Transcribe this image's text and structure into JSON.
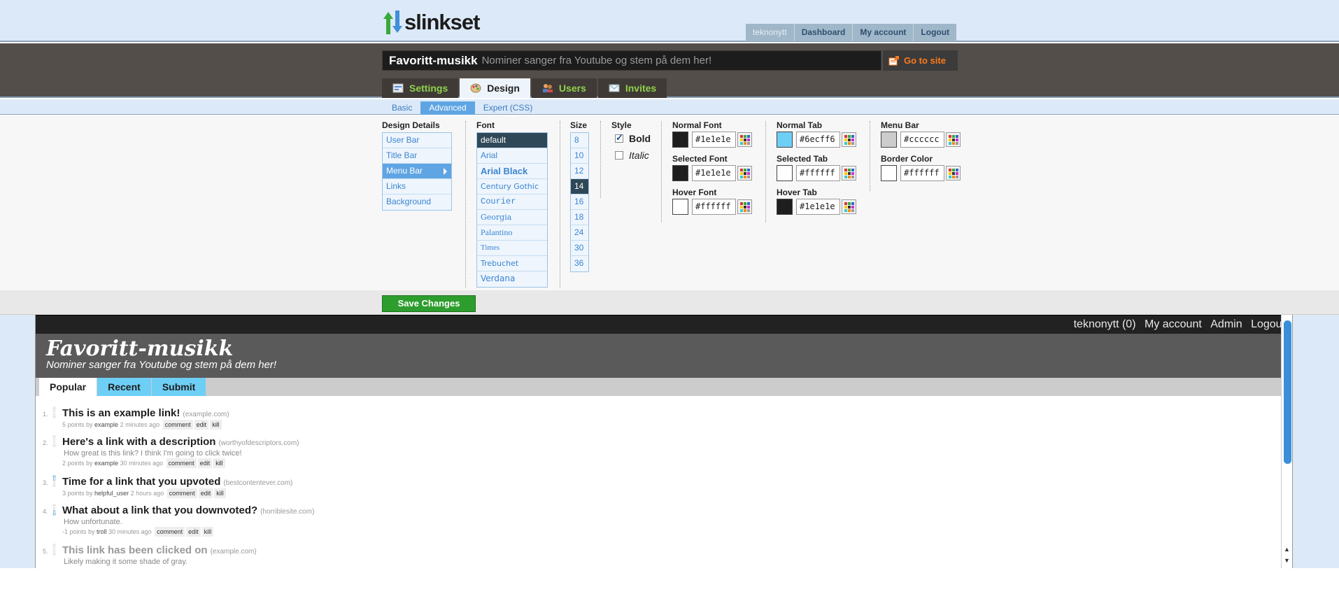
{
  "app": {
    "logo_text": "slinkset"
  },
  "topnav": {
    "user": "teknonytt",
    "dashboard": "Dashboard",
    "my_account": "My account",
    "logout": "Logout"
  },
  "site": {
    "name": "Favoritt-musikk",
    "tagline": "Nominer sanger fra Youtube og stem på dem her!",
    "goto": "Go to site"
  },
  "tabs": [
    {
      "label": "Settings",
      "icon": "settings-icon"
    },
    {
      "label": "Design",
      "icon": "palette-icon",
      "active": true
    },
    {
      "label": "Users",
      "icon": "users-icon"
    },
    {
      "label": "Invites",
      "icon": "envelope-icon"
    }
  ],
  "subtabs": [
    {
      "label": "Basic"
    },
    {
      "label": "Advanced",
      "active": true
    },
    {
      "label": "Expert (CSS)"
    }
  ],
  "design": {
    "details_label": "Design Details",
    "details": [
      "User Bar",
      "Title Bar",
      "Menu Bar",
      "Links",
      "Background"
    ],
    "details_selected": "Menu Bar",
    "font_label": "Font",
    "fonts": [
      "default",
      "Arial",
      "Arial Black",
      "Century Gothic",
      "Courier",
      "Georgia",
      "Palantino",
      "Times",
      "Trebuchet",
      "Verdana"
    ],
    "font_selected": "default",
    "size_label": "Size",
    "sizes": [
      "8",
      "10",
      "12",
      "14",
      "16",
      "18",
      "24",
      "30",
      "36"
    ],
    "size_selected": "14",
    "style_label": "Style",
    "bold": "Bold",
    "italic": "Italic",
    "bold_checked": true,
    "italic_checked": false,
    "colors": {
      "normal_font": {
        "label": "Normal Font",
        "value": "#1e1e1e",
        "swatch": "#1e1e1e"
      },
      "selected_font": {
        "label": "Selected Font",
        "value": "#1e1e1e",
        "swatch": "#1e1e1e"
      },
      "hover_font": {
        "label": "Hover Font",
        "value": "#ffffff",
        "swatch": "#ffffff"
      },
      "normal_tab": {
        "label": "Normal Tab",
        "value": "#6ecff6",
        "swatch": "#6ecff6"
      },
      "selected_tab": {
        "label": "Selected Tab",
        "value": "#ffffff",
        "swatch": "#ffffff"
      },
      "hover_tab": {
        "label": "Hover Tab",
        "value": "#1e1e1e",
        "swatch": "#1e1e1e"
      },
      "menu_bar": {
        "label": "Menu Bar",
        "value": "#cccccc",
        "swatch": "#cccccc"
      },
      "border_color": {
        "label": "Border Color",
        "value": "#ffffff",
        "swatch": "#ffffff"
      }
    },
    "save": "Save Changes"
  },
  "preview": {
    "nav": [
      "teknonytt (0)",
      "My account",
      "Admin",
      "Logout"
    ],
    "title": "Favoritt-musikk",
    "tagline": "Nominer sanger fra Youtube og stem på dem her!",
    "menu": [
      "Popular",
      "Recent",
      "Submit"
    ],
    "menu_selected": "Popular",
    "links": [
      {
        "num": "1.",
        "title": "This is an example link!",
        "domain": "(example.com)",
        "desc": "",
        "points": "5 points by",
        "user": "example",
        "age": "2 minutes ago",
        "vote": "none"
      },
      {
        "num": "2.",
        "title": "Here's a link with a description",
        "domain": "(worthyofdescriptors.com)",
        "desc": "How great is this link? I think I'm going to click twice!",
        "points": "2 points by",
        "user": "example",
        "age": "30 minutes ago",
        "vote": "none"
      },
      {
        "num": "3.",
        "title": "Time for a link that you upvoted",
        "domain": "(bestcontentever.com)",
        "desc": "",
        "points": "3 points by",
        "user": "helpful_user",
        "age": "2 hours ago",
        "vote": "up"
      },
      {
        "num": "4.",
        "title": "What about a link that you downvoted?",
        "domain": "(horriblesite.com)",
        "desc": "How unfortunate.",
        "points": "-1 points by",
        "user": "troll",
        "age": "30 minutes ago",
        "vote": "down"
      },
      {
        "num": "5.",
        "title": "This link has been clicked on",
        "domain": "(example.com)",
        "desc": "Likely making it some shade of gray.",
        "points": "",
        "user": "",
        "age": "",
        "vote": "none"
      }
    ],
    "actions": [
      "comment",
      "edit",
      "kill"
    ]
  }
}
